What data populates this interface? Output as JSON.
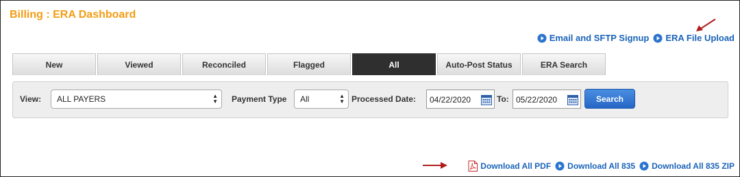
{
  "page": {
    "title": "Billing : ERA Dashboard"
  },
  "top_links": [
    {
      "label": "Email and SFTP Signup",
      "icon": "play-circle-icon"
    },
    {
      "label": "ERA File Upload",
      "icon": "play-circle-icon"
    }
  ],
  "tabs": [
    {
      "label": "New",
      "active": false
    },
    {
      "label": "Viewed",
      "active": false
    },
    {
      "label": "Reconciled",
      "active": false
    },
    {
      "label": "Flagged",
      "active": false
    },
    {
      "label": "All",
      "active": true
    },
    {
      "label": "Auto-Post Status",
      "active": false
    },
    {
      "label": "ERA Search",
      "active": false
    }
  ],
  "filters": {
    "view_label": "View:",
    "view_value": "ALL PAYERS",
    "payment_type_label": "Payment Type",
    "payment_type_value": "All",
    "processed_date_label": "Processed Date:",
    "from_date": "04/22/2020",
    "to_label": "To:",
    "to_date": "05/22/2020",
    "search_label": "Search"
  },
  "bottom_links": [
    {
      "label": "Download All PDF",
      "icon": "pdf-icon"
    },
    {
      "label": "Download All 835",
      "icon": "play-circle-icon"
    },
    {
      "label": "Download All 835 ZIP",
      "icon": "play-circle-icon"
    }
  ],
  "colors": {
    "title": "#f39c12",
    "link": "#1a63b8",
    "active_tab": "#2f2f2f",
    "button": "#2f72d0",
    "annotation_arrow": "#b01c1c"
  }
}
